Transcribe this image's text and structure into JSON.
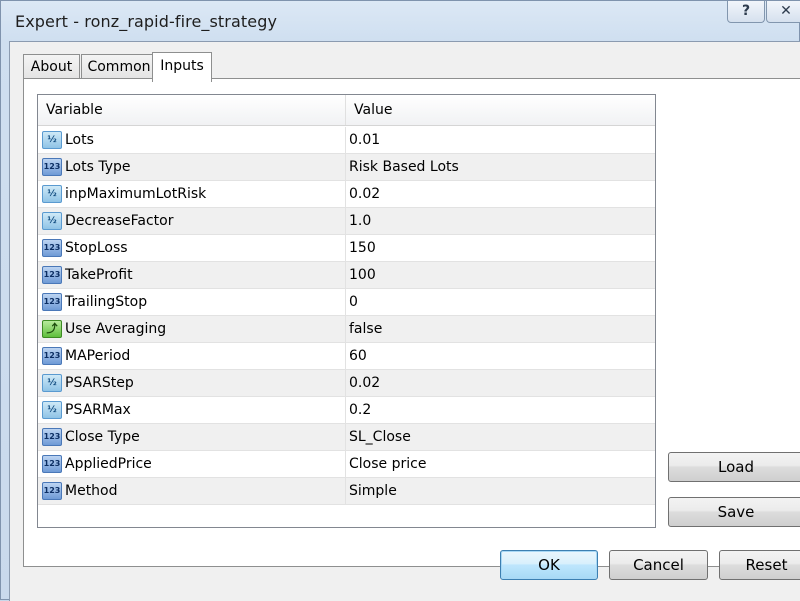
{
  "window": {
    "title": "Expert - ronz_rapid-fire_strategy"
  },
  "titlebar": {
    "help_label": "?",
    "close_label": "✕"
  },
  "tabs": [
    {
      "label": "About"
    },
    {
      "label": "Common"
    },
    {
      "label": "Inputs"
    }
  ],
  "grid": {
    "header": {
      "variable": "Variable",
      "value": "Value"
    },
    "rows": [
      {
        "type": "frac",
        "icon": "½",
        "name": "Lots",
        "value": "0.01"
      },
      {
        "type": "int",
        "icon": "123",
        "name": "Lots Type",
        "value": "Risk Based Lots"
      },
      {
        "type": "frac",
        "icon": "½",
        "name": "inpMaximumLotRisk",
        "value": "0.02"
      },
      {
        "type": "frac",
        "icon": "½",
        "name": "DecreaseFactor",
        "value": "1.0"
      },
      {
        "type": "int",
        "icon": "123",
        "name": "StopLoss",
        "value": "150"
      },
      {
        "type": "int",
        "icon": "123",
        "name": "TakeProfit",
        "value": "100"
      },
      {
        "type": "int",
        "icon": "123",
        "name": "TrailingStop",
        "value": "0"
      },
      {
        "type": "bool",
        "icon": "⤴",
        "name": "Use Averaging",
        "value": "false"
      },
      {
        "type": "int",
        "icon": "123",
        "name": "MAPeriod",
        "value": "60"
      },
      {
        "type": "frac",
        "icon": "½",
        "name": "PSARStep",
        "value": "0.02"
      },
      {
        "type": "frac",
        "icon": "½",
        "name": "PSARMax",
        "value": "0.2"
      },
      {
        "type": "int",
        "icon": "123",
        "name": "Close Type",
        "value": "SL_Close"
      },
      {
        "type": "int",
        "icon": "123",
        "name": "AppliedPrice",
        "value": "Close price"
      },
      {
        "type": "int",
        "icon": "123",
        "name": "Method",
        "value": "Simple"
      }
    ]
  },
  "side_buttons": {
    "load": "Load",
    "save": "Save"
  },
  "footer": {
    "ok": "OK",
    "cancel": "Cancel",
    "reset": "Reset"
  },
  "icons": {
    "frac": "fraction-type-icon",
    "int": "integer-type-icon",
    "bool": "boolean-type-icon"
  }
}
